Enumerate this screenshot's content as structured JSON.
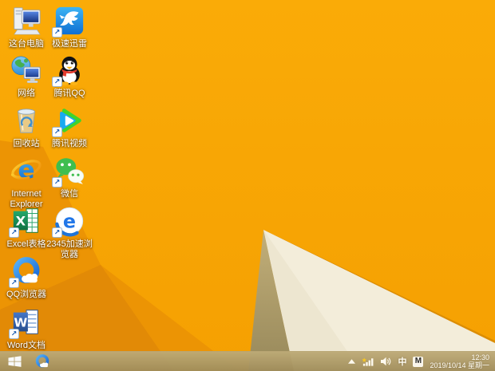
{
  "desktop": {
    "icons": [
      {
        "id": "this-pc",
        "label": "这台电脑",
        "shortcut_arrow": false
      },
      {
        "id": "xunlei",
        "label": "极速迅雷",
        "shortcut_arrow": true
      },
      {
        "id": "network",
        "label": "网络",
        "shortcut_arrow": false
      },
      {
        "id": "tencent-qq",
        "label": "腾讯QQ",
        "shortcut_arrow": true
      },
      {
        "id": "recycle-bin",
        "label": "回收站",
        "shortcut_arrow": false
      },
      {
        "id": "tencent-video",
        "label": "腾讯视频",
        "shortcut_arrow": true
      },
      {
        "id": "internet-explorer",
        "label": "Internet Explorer",
        "shortcut_arrow": false
      },
      {
        "id": "wechat",
        "label": "微信",
        "shortcut_arrow": true
      },
      {
        "id": "excel",
        "label": "Excel表格",
        "shortcut_arrow": true
      },
      {
        "id": "2345-browser",
        "label": "2345加速浏览器",
        "shortcut_arrow": true
      },
      {
        "id": "qq-browser",
        "label": "QQ浏览器",
        "shortcut_arrow": true
      },
      {
        "id": "word",
        "label": "Word文档",
        "shortcut_arrow": true
      }
    ],
    "shortcut_arrow_glyph": "↗"
  },
  "taskbar": {
    "start": {
      "icon": "windows-logo"
    },
    "pinned": [
      {
        "id": "qq-browser",
        "icon": "qq-browser"
      }
    ],
    "tray": {
      "hidden_icons_glyph": "▲",
      "network_icon": "wifi-limited-warning",
      "volume_icon": "speaker",
      "ime_chinese": "中",
      "ime_badge": "M",
      "time": "12:30",
      "date": "2019/10/14 星期一"
    }
  },
  "colors": {
    "wallpaper_amber": "#F8A504",
    "wallpaper_amber_dark": "#E99104",
    "wallpaper_fold_dark": "#E08A06",
    "wallpaper_ridge": "#DC8D03",
    "wallpaper_cream": "#F3EDDA",
    "wallpaper_cream_shade": "#EDE6D0",
    "wallpaper_tan_shadow": "#AE9D68",
    "taskbar": "#AC9667"
  }
}
